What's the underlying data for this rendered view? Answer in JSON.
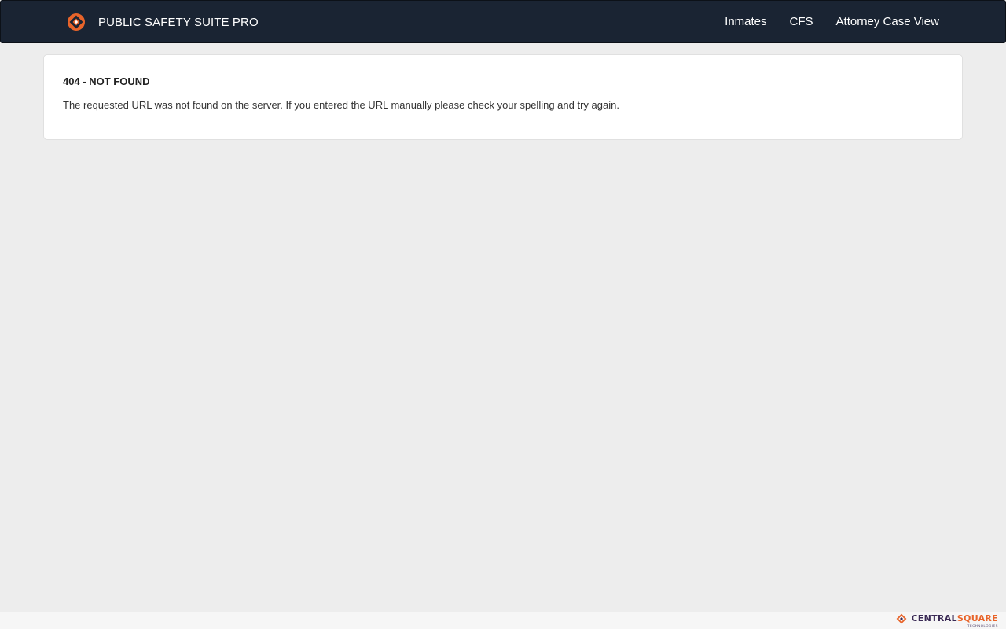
{
  "navbar": {
    "brand_title": "PUBLIC SAFETY SUITE PRO",
    "brand_icon": "brand-logo-icon",
    "links": [
      {
        "label": "Inmates"
      },
      {
        "label": "CFS"
      },
      {
        "label": "Attorney Case View"
      }
    ]
  },
  "error": {
    "title": "404 - NOT FOUND",
    "message": "The requested URL was not found on the server. If you entered the URL manually please check your spelling and try again."
  },
  "footer": {
    "logo_part_a": "CENTRAL",
    "logo_part_b": "SQUARE",
    "logo_sub": "TECHNOLOGIES"
  },
  "colors": {
    "navbar_bg": "#1a2433",
    "accent_orange": "#e8642a",
    "page_bg": "#ededed"
  }
}
